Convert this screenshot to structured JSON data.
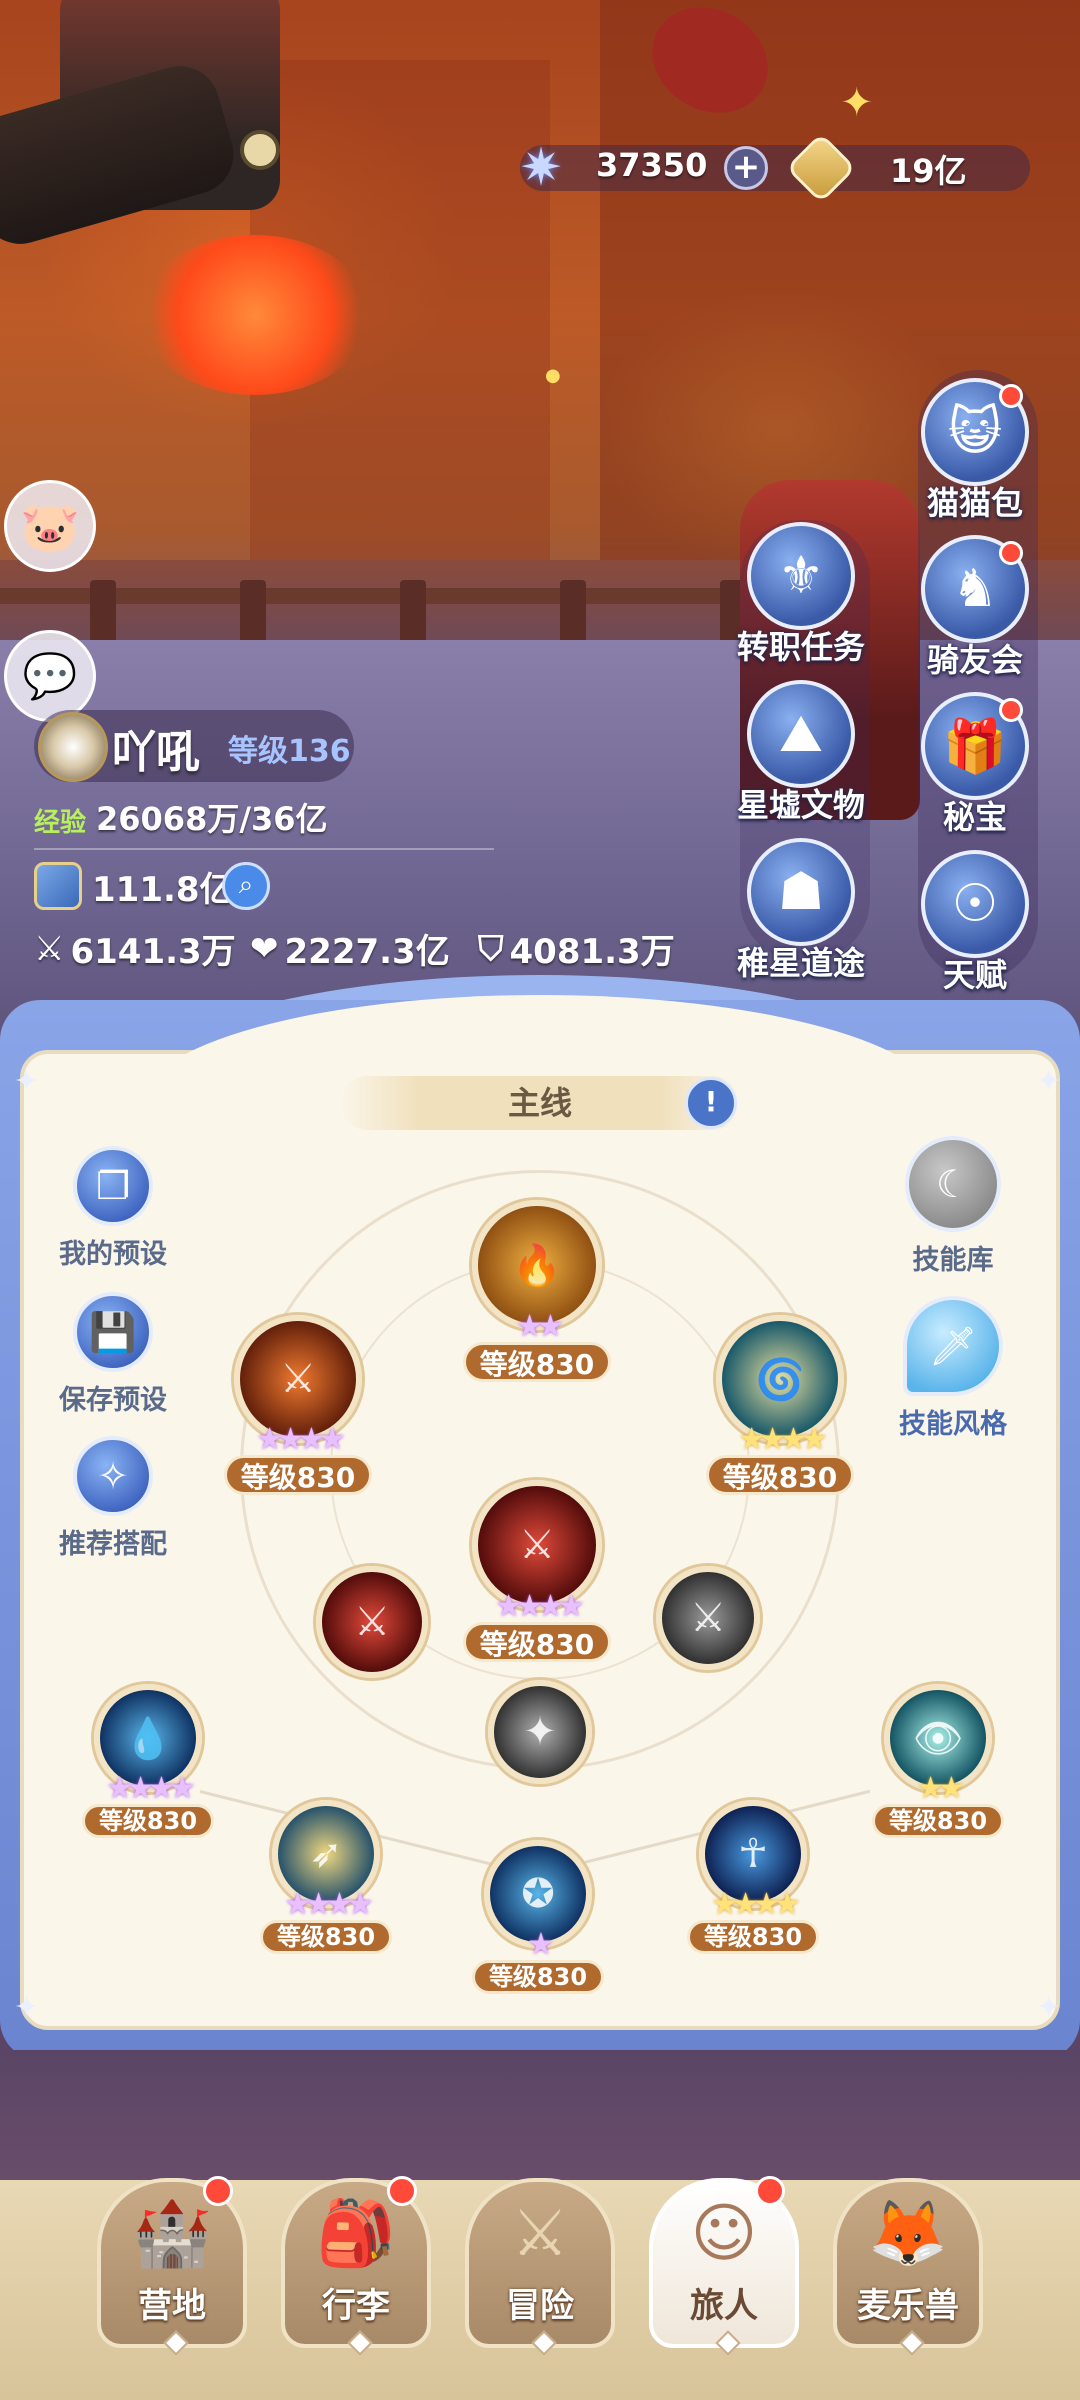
{
  "currency": {
    "stars": "37350",
    "gold": "19亿"
  },
  "player": {
    "name": "吖吼",
    "level": "等级136",
    "exp_label": "经验",
    "exp_value": "26068万/36亿",
    "power": "111.8亿",
    "attack": "6141.3万",
    "hp": "2227.3亿",
    "defense": "4081.3万"
  },
  "features": {
    "cat_bag": "猫猫包",
    "class_quest": "转职任务",
    "rider_club": "骑友会",
    "star_ruins": "星墟文物",
    "secret_treasure": "秘宝",
    "star_path": "稚星道途",
    "talent": "天赋"
  },
  "panel": {
    "title": "主线",
    "my_preset": "我的预设",
    "save_preset": "保存预设",
    "recommend": "推荐搭配",
    "skill_library": "技能库",
    "skill_style": "技能风格"
  },
  "skills": {
    "top": "等级830",
    "upper_left": "等级830",
    "upper_right": "等级830",
    "center": "等级830",
    "left_far": "等级830",
    "right_far": "等级830",
    "lower_left": "等级830",
    "lower_right": "等级830",
    "bottom": "等级830"
  },
  "nav": {
    "camp": "营地",
    "luggage": "行李",
    "adventure": "冒险",
    "traveler": "旅人",
    "pet": "麦乐兽"
  },
  "colors": {
    "panel_blue": "#8aa4e8",
    "panel_cream": "#fbf6ea",
    "level_badge": "#b06a2e",
    "badge_red": "#ff4a3a"
  }
}
